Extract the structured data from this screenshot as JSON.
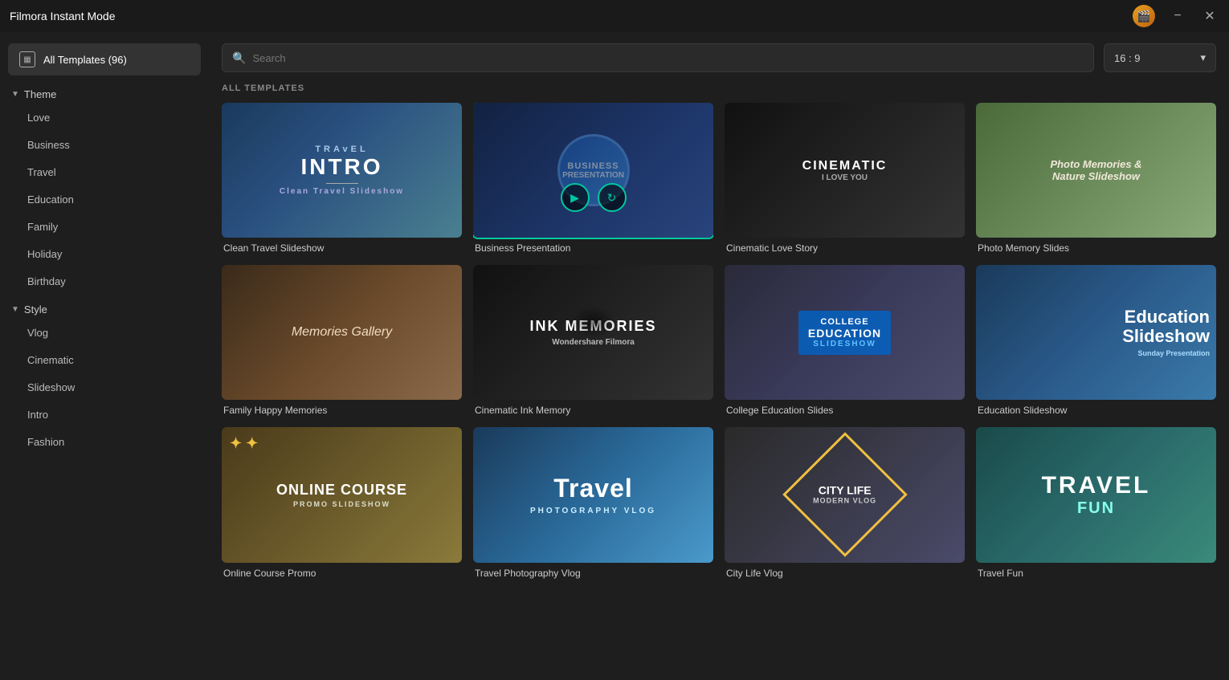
{
  "titlebar": {
    "title": "Filmora Instant Mode",
    "minimize_label": "−",
    "close_label": "✕"
  },
  "sidebar": {
    "all_templates_label": "All Templates (96)",
    "theme_section": "Theme",
    "theme_items": [
      {
        "label": "Love"
      },
      {
        "label": "Business"
      },
      {
        "label": "Travel"
      },
      {
        "label": "Education"
      },
      {
        "label": "Family"
      },
      {
        "label": "Holiday"
      },
      {
        "label": "Birthday"
      }
    ],
    "style_section": "Style",
    "style_items": [
      {
        "label": "Vlog"
      },
      {
        "label": "Cinematic"
      },
      {
        "label": "Slideshow"
      },
      {
        "label": "Intro"
      },
      {
        "label": "Fashion"
      }
    ]
  },
  "header": {
    "search_placeholder": "Search",
    "aspect_ratio": "16 : 9"
  },
  "content": {
    "section_label": "ALL TEMPLATES"
  },
  "templates": [
    {
      "id": "clean-travel",
      "name": "Clean Travel Slideshow",
      "selected": false
    },
    {
      "id": "business-presentation",
      "name": "Business Presentation",
      "selected": true
    },
    {
      "id": "cinematic-love",
      "name": "Cinematic Love Story",
      "selected": false
    },
    {
      "id": "photo-memory",
      "name": "Photo Memory Slides",
      "selected": false
    },
    {
      "id": "family-happy",
      "name": "Family Happy Memories",
      "selected": false
    },
    {
      "id": "ink-memory",
      "name": "Cinematic Ink Memory",
      "selected": false
    },
    {
      "id": "college-edu",
      "name": "College Education Slides",
      "selected": false
    },
    {
      "id": "edu-slideshow",
      "name": "Education Slideshow",
      "selected": false
    },
    {
      "id": "online-course",
      "name": "Online Course Promo",
      "selected": false
    },
    {
      "id": "travel-photo",
      "name": "Travel Photography Vlog",
      "selected": false
    },
    {
      "id": "city-life",
      "name": "City Life Vlog",
      "selected": false
    },
    {
      "id": "travel-fun",
      "name": "Travel Fun",
      "selected": false
    }
  ]
}
